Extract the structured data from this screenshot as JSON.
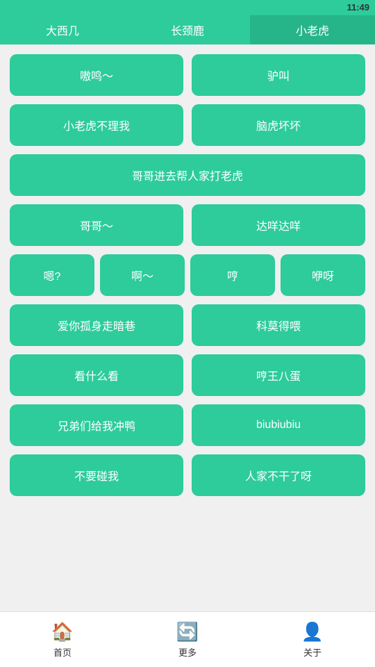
{
  "statusBar": {
    "time": "11:49"
  },
  "topTabs": [
    {
      "label": "大西几",
      "active": false
    },
    {
      "label": "长颈鹿",
      "active": false
    },
    {
      "label": "小老虎",
      "active": true
    }
  ],
  "buttons": [
    [
      {
        "label": "嗷鸣～"
      },
      {
        "label": "驴叫"
      }
    ],
    [
      {
        "label": "小老虎不理我"
      },
      {
        "label": "脑虎坏坏"
      }
    ],
    [
      {
        "label": "哥哥进去帮人家打老虎",
        "full": true
      }
    ],
    [
      {
        "label": "哥哥～"
      },
      {
        "label": "达咩达咩"
      }
    ],
    [
      {
        "label": "嗯?"
      },
      {
        "label": "啊～"
      },
      {
        "label": "哼"
      },
      {
        "label": "咿呀"
      }
    ],
    [
      {
        "label": "爱你孤身走暗巷"
      },
      {
        "label": "科莫得喂"
      }
    ],
    [
      {
        "label": "看什么看"
      },
      {
        "label": "哼王八蛋"
      }
    ],
    [
      {
        "label": "兄弟们给我冲鸭"
      },
      {
        "label": "biubiubiu"
      }
    ],
    [
      {
        "label": "不要碰我"
      },
      {
        "label": "人家不干了呀"
      }
    ]
  ],
  "bottomNav": [
    {
      "icon": "🏠",
      "label": "首页"
    },
    {
      "icon": "🔄",
      "label": "更多"
    },
    {
      "icon": "👤",
      "label": "关于"
    }
  ]
}
